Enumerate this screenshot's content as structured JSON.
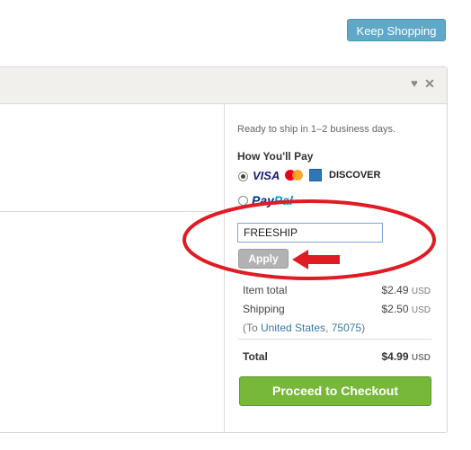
{
  "header": {
    "keep_shopping": "Keep Shopping"
  },
  "sidebar": {
    "ready_text": "Ready to ship in 1–2 business days.",
    "how_pay": "How You'll Pay",
    "payment_methods": {
      "visa": "VISA",
      "discover": "DISCOVER",
      "paypal_a": "Pay",
      "paypal_b": "Pal"
    },
    "selected_payment": "card"
  },
  "coupon": {
    "value": "FREESHIP",
    "apply_label": "Apply"
  },
  "summary": {
    "item_total_label": "Item total",
    "item_total_amount": "$2.49",
    "shipping_label": "Shipping",
    "shipping_amount": "$2.50",
    "currency": "USD",
    "dest_prefix": "(To ",
    "dest_country": "United States",
    "dest_sep": ", ",
    "dest_zip": "75075",
    "dest_suffix": ")",
    "total_label": "Total",
    "total_amount": "$4.99"
  },
  "checkout": {
    "label": "Proceed to Checkout"
  },
  "colors": {
    "keep_shopping": "#5fa8c8",
    "checkout": "#77b83a",
    "annotation": "#e01b24",
    "link": "#3b79a3"
  },
  "icons": [
    "heart-icon",
    "close-icon",
    "visa-logo",
    "mastercard-logo",
    "amex-logo",
    "discover-logo",
    "paypal-logo",
    "red-arrow-icon"
  ]
}
